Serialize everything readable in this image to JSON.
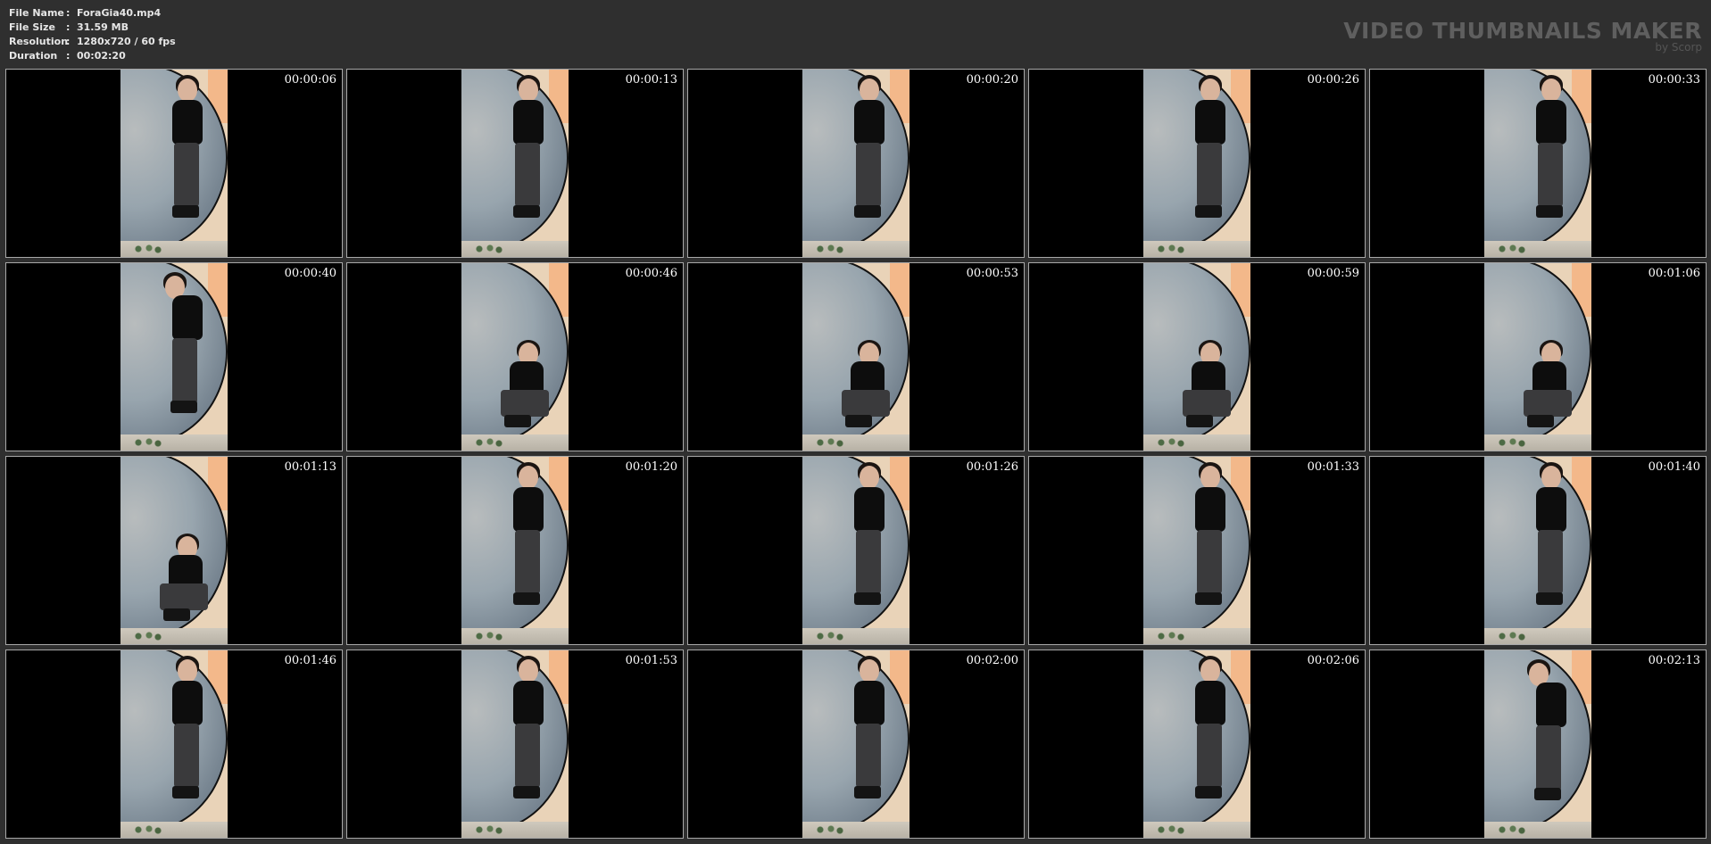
{
  "meta": {
    "rows": [
      {
        "key": "File Name",
        "sep": ":",
        "value": "ForaGia40.mp4"
      },
      {
        "key": "File Size",
        "sep": ":",
        "value": "31.59 MB"
      },
      {
        "key": "Resolution",
        "sep": ":",
        "value": "1280x720 / 60 fps"
      },
      {
        "key": "Duration",
        "sep": ":",
        "value": "00:02:20"
      }
    ]
  },
  "brand": {
    "title": "VIDEO THUMBNAILS MAKER",
    "subtitle": "by Scorp"
  },
  "colors": {
    "background": "#2f2f2f",
    "thumb_border": "#a8a8a8",
    "timestamp": "#ffffff",
    "brand": "#5f5f5f"
  },
  "thumbnails": [
    {
      "time": "00:00:06",
      "pose": "standing"
    },
    {
      "time": "00:00:13",
      "pose": "standing"
    },
    {
      "time": "00:00:20",
      "pose": "standing"
    },
    {
      "time": "00:00:26",
      "pose": "standing"
    },
    {
      "time": "00:00:33",
      "pose": "standing"
    },
    {
      "time": "00:00:40",
      "pose": "bending"
    },
    {
      "time": "00:00:46",
      "pose": "crouching"
    },
    {
      "time": "00:00:53",
      "pose": "crouching"
    },
    {
      "time": "00:00:59",
      "pose": "crouching"
    },
    {
      "time": "00:01:06",
      "pose": "crouching"
    },
    {
      "time": "00:01:13",
      "pose": "crouching"
    },
    {
      "time": "00:01:20",
      "pose": "standing"
    },
    {
      "time": "00:01:26",
      "pose": "standing"
    },
    {
      "time": "00:01:33",
      "pose": "standing"
    },
    {
      "time": "00:01:40",
      "pose": "standing"
    },
    {
      "time": "00:01:46",
      "pose": "standing"
    },
    {
      "time": "00:01:53",
      "pose": "standing"
    },
    {
      "time": "00:02:00",
      "pose": "standing"
    },
    {
      "time": "00:02:06",
      "pose": "standing"
    },
    {
      "time": "00:02:13",
      "pose": "bending"
    }
  ]
}
